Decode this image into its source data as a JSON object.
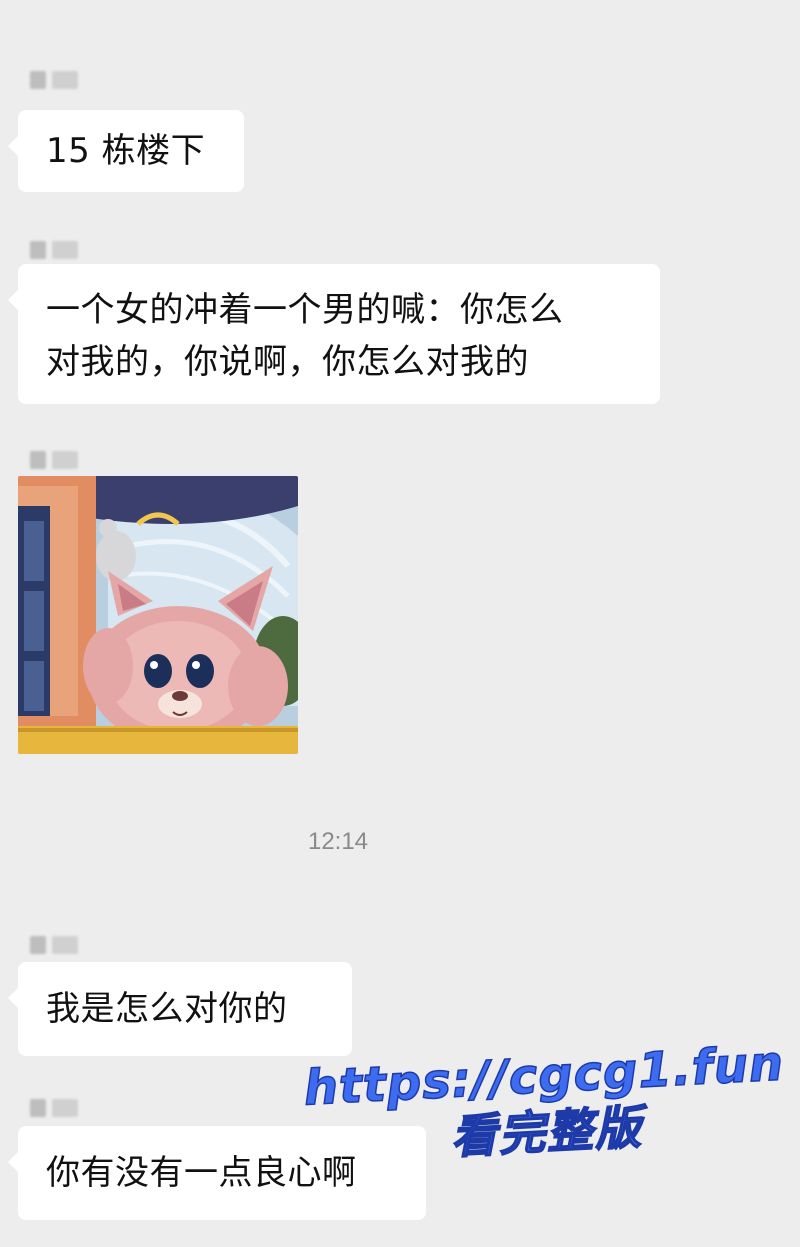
{
  "messages": [
    {
      "text": "15 栋楼下"
    },
    {
      "line1": "一个女的冲着一个男的喊：你怎么",
      "line2": "对我的，你说啊，你怎么对我的"
    },
    {
      "sticker": "pink-fox-plush-sticker"
    },
    {
      "text": "我是怎么对你的"
    },
    {
      "text": "你有没有一点良心啊"
    }
  ],
  "timestamp": "12:14",
  "watermark": {
    "url": "https://cgcg1.fun",
    "cta": "看完整版"
  },
  "colors": {
    "background": "#ededed",
    "bubble": "#ffffff",
    "watermark": "#3d6cf0"
  }
}
